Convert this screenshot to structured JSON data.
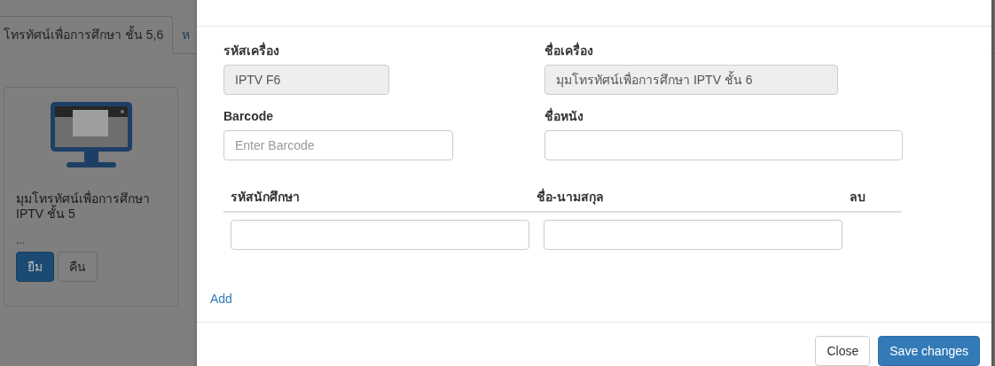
{
  "background": {
    "tabs": [
      {
        "label": "โทรทัศน์เพื่อการศึกษา ชั้น 5,6",
        "selected": true
      },
      {
        "label": "ห",
        "selected": false
      }
    ],
    "card": {
      "title": "มุมโทรทัศน์เพื่อการศึกษา IPTV ชั้น 5",
      "note": "...",
      "buttons": [
        {
          "label": "ยืม",
          "kind": "primary"
        },
        {
          "label": "คืน",
          "kind": "default"
        }
      ]
    }
  },
  "modal": {
    "fields": [
      {
        "label": "รหัสเครื่อง",
        "value": "IPTV F6",
        "disabled": true
      },
      {
        "label": "ชื่อเครื่อง",
        "value": "มุมโทรทัศน์เพื่อการศึกษา IPTV ชั้น 6",
        "disabled": true
      },
      {
        "label": "Barcode",
        "placeholder": "Enter Barcode",
        "disabled": false
      },
      {
        "label": "ชื่อหนัง",
        "disabled": false
      }
    ],
    "table": {
      "columns": [
        "รหัสนักศึกษา",
        "ชื่อ-นามสกุล",
        "ลบ"
      ],
      "rows": [
        {
          "student_id": "",
          "name": ""
        }
      ]
    },
    "add_link": "Add",
    "footer": [
      {
        "label": "Close",
        "kind": "default"
      },
      {
        "label": "Save changes",
        "kind": "primary"
      }
    ]
  }
}
